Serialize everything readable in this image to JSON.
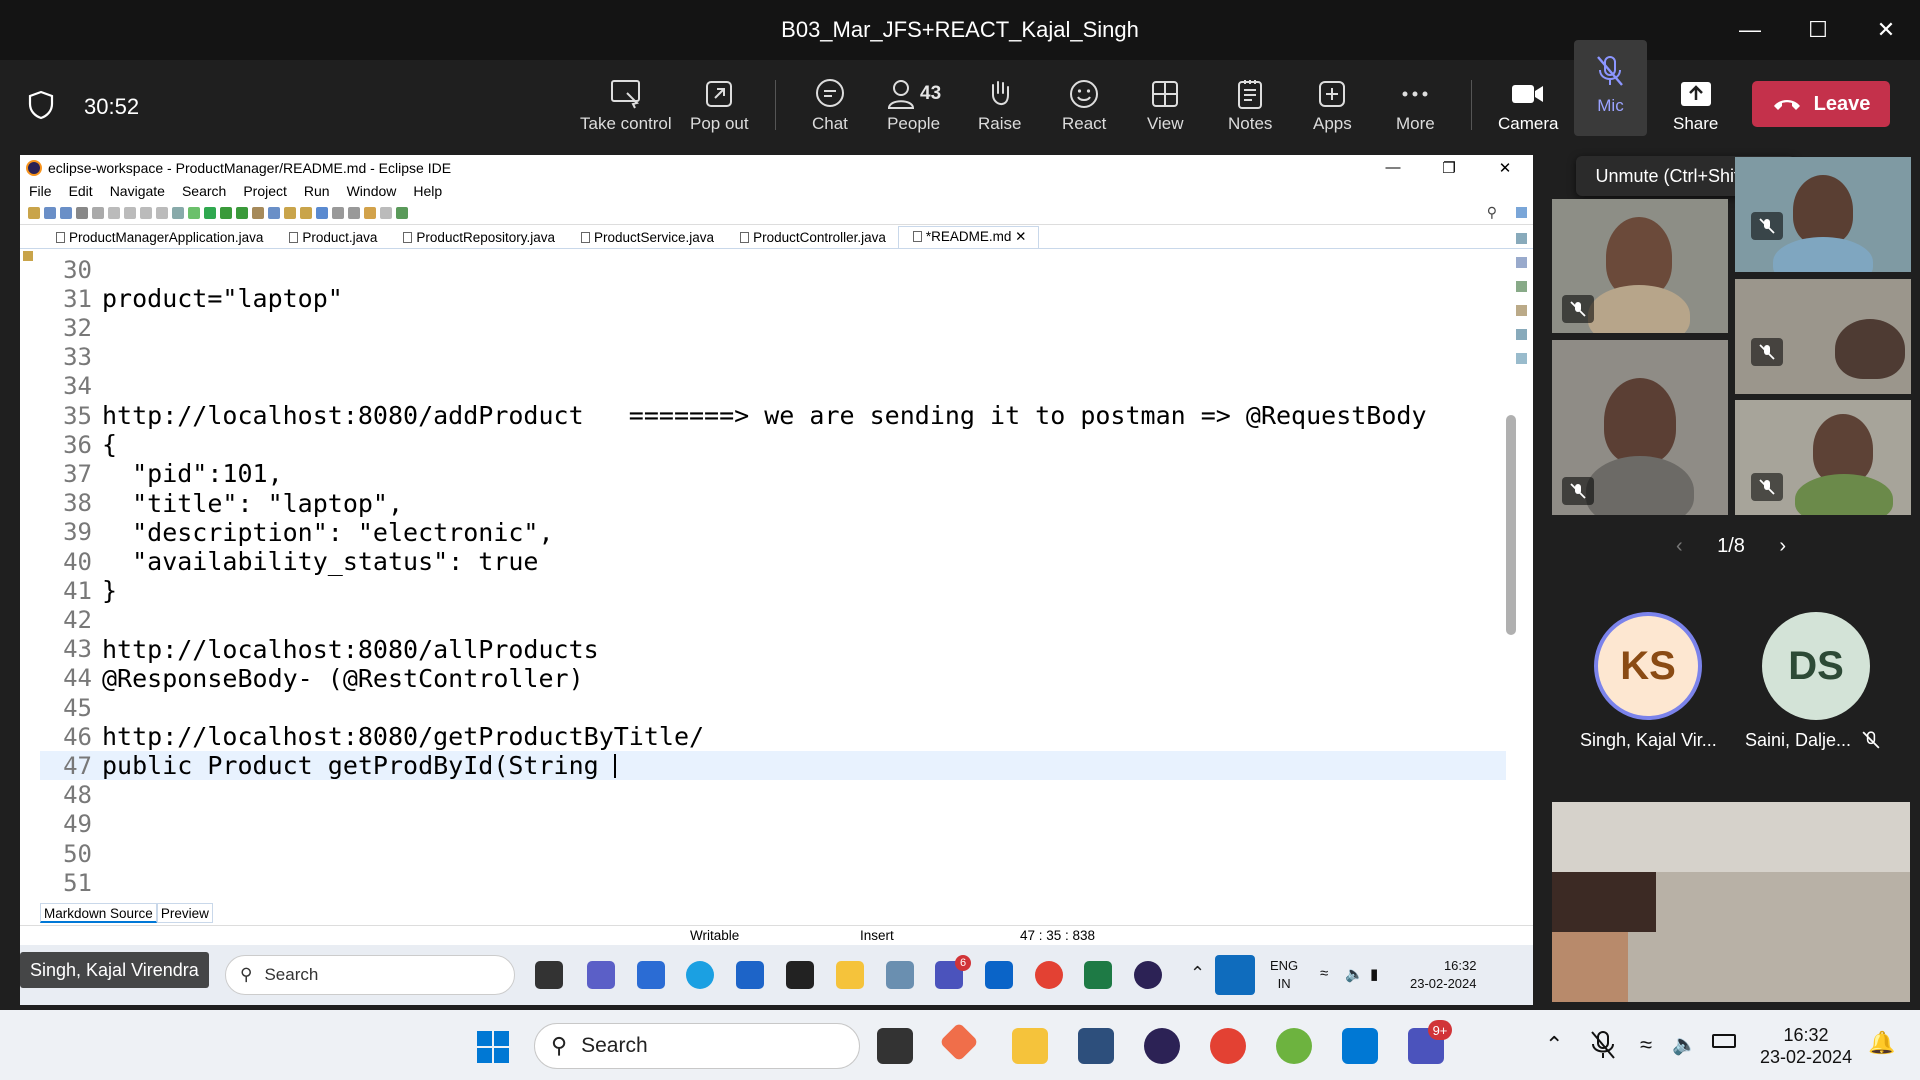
{
  "meeting": {
    "title": "B03_Mar_JFS+REACT_Kajal_Singh",
    "timer": "30:52",
    "buttons": {
      "take_control": "Take control",
      "pop_out": "Pop out",
      "chat": "Chat",
      "people": "People",
      "people_count": "43",
      "raise": "Raise",
      "react": "React",
      "view": "View",
      "notes": "Notes",
      "apps": "Apps",
      "more": "More",
      "camera": "Camera",
      "mic": "Mic",
      "share": "Share",
      "leave": "Leave"
    },
    "tooltip": "Unmute (Ctrl+Shift+M)",
    "pager": "1/8",
    "participants": [
      {
        "initials": "KS",
        "name": "Singh, Kajal Vir..."
      },
      {
        "initials": "DS",
        "name": "Saini, Dalje..."
      }
    ],
    "presenter_label": "Singh, Kajal Virendra",
    "colors": {
      "leave": "#c4314b",
      "ks_ring": "#7b83eb",
      "ks_bg": "#fde7d1",
      "ks_text": "#8a4b14",
      "ds_bg": "#d3e3d7",
      "ds_text": "#2d4a36"
    }
  },
  "eclipse": {
    "title": "eclipse-workspace - ProductManager/README.md - Eclipse IDE",
    "menu": [
      "File",
      "Edit",
      "Navigate",
      "Search",
      "Project",
      "Run",
      "Window",
      "Help"
    ],
    "tabs": [
      "ProductManagerApplication.java",
      "Product.java",
      "ProductRepository.java",
      "ProductService.java",
      "ProductController.java",
      "*README.md"
    ],
    "active_tab": "*README.md",
    "lines": [
      {
        "n": "30",
        "code": ""
      },
      {
        "n": "31",
        "code": "product=\"laptop\""
      },
      {
        "n": "32",
        "code": ""
      },
      {
        "n": "33",
        "code": ""
      },
      {
        "n": "34",
        "code": ""
      },
      {
        "n": "35",
        "code": "http://localhost:8080/addProduct   =======> we are sending it to postman => @RequestBody"
      },
      {
        "n": "36",
        "code": "{"
      },
      {
        "n": "37",
        "code": "  \"pid\":101,"
      },
      {
        "n": "38",
        "code": "  \"title\": \"laptop\","
      },
      {
        "n": "39",
        "code": "  \"description\": \"electronic\","
      },
      {
        "n": "40",
        "code": "  \"availability_status\": true"
      },
      {
        "n": "41",
        "code": "}"
      },
      {
        "n": "42",
        "code": ""
      },
      {
        "n": "43",
        "code": "http://localhost:8080/allProducts"
      },
      {
        "n": "44",
        "code": "@ResponseBody- (@RestController)"
      },
      {
        "n": "45",
        "code": ""
      },
      {
        "n": "46",
        "code": "http://localhost:8080/getProductByTitle/"
      },
      {
        "n": "47",
        "code": "public Product getProdById(String "
      },
      {
        "n": "48",
        "code": ""
      },
      {
        "n": "49",
        "code": ""
      },
      {
        "n": "50",
        "code": ""
      },
      {
        "n": "51",
        "code": ""
      }
    ],
    "current_line": "47",
    "bottom_tabs": [
      "Markdown Source",
      "Preview"
    ],
    "status": {
      "mode": "Writable",
      "insert": "Insert",
      "position": "47 : 35 : 838"
    }
  },
  "inner_taskbar": {
    "search": "Search",
    "lang": "ENG",
    "region": "IN",
    "time": "16:32",
    "date": "23-02-2024",
    "badge_a": "6"
  },
  "taskbar": {
    "search": "Search",
    "time": "16:32",
    "date": "23-02-2024",
    "badge": "9+"
  }
}
